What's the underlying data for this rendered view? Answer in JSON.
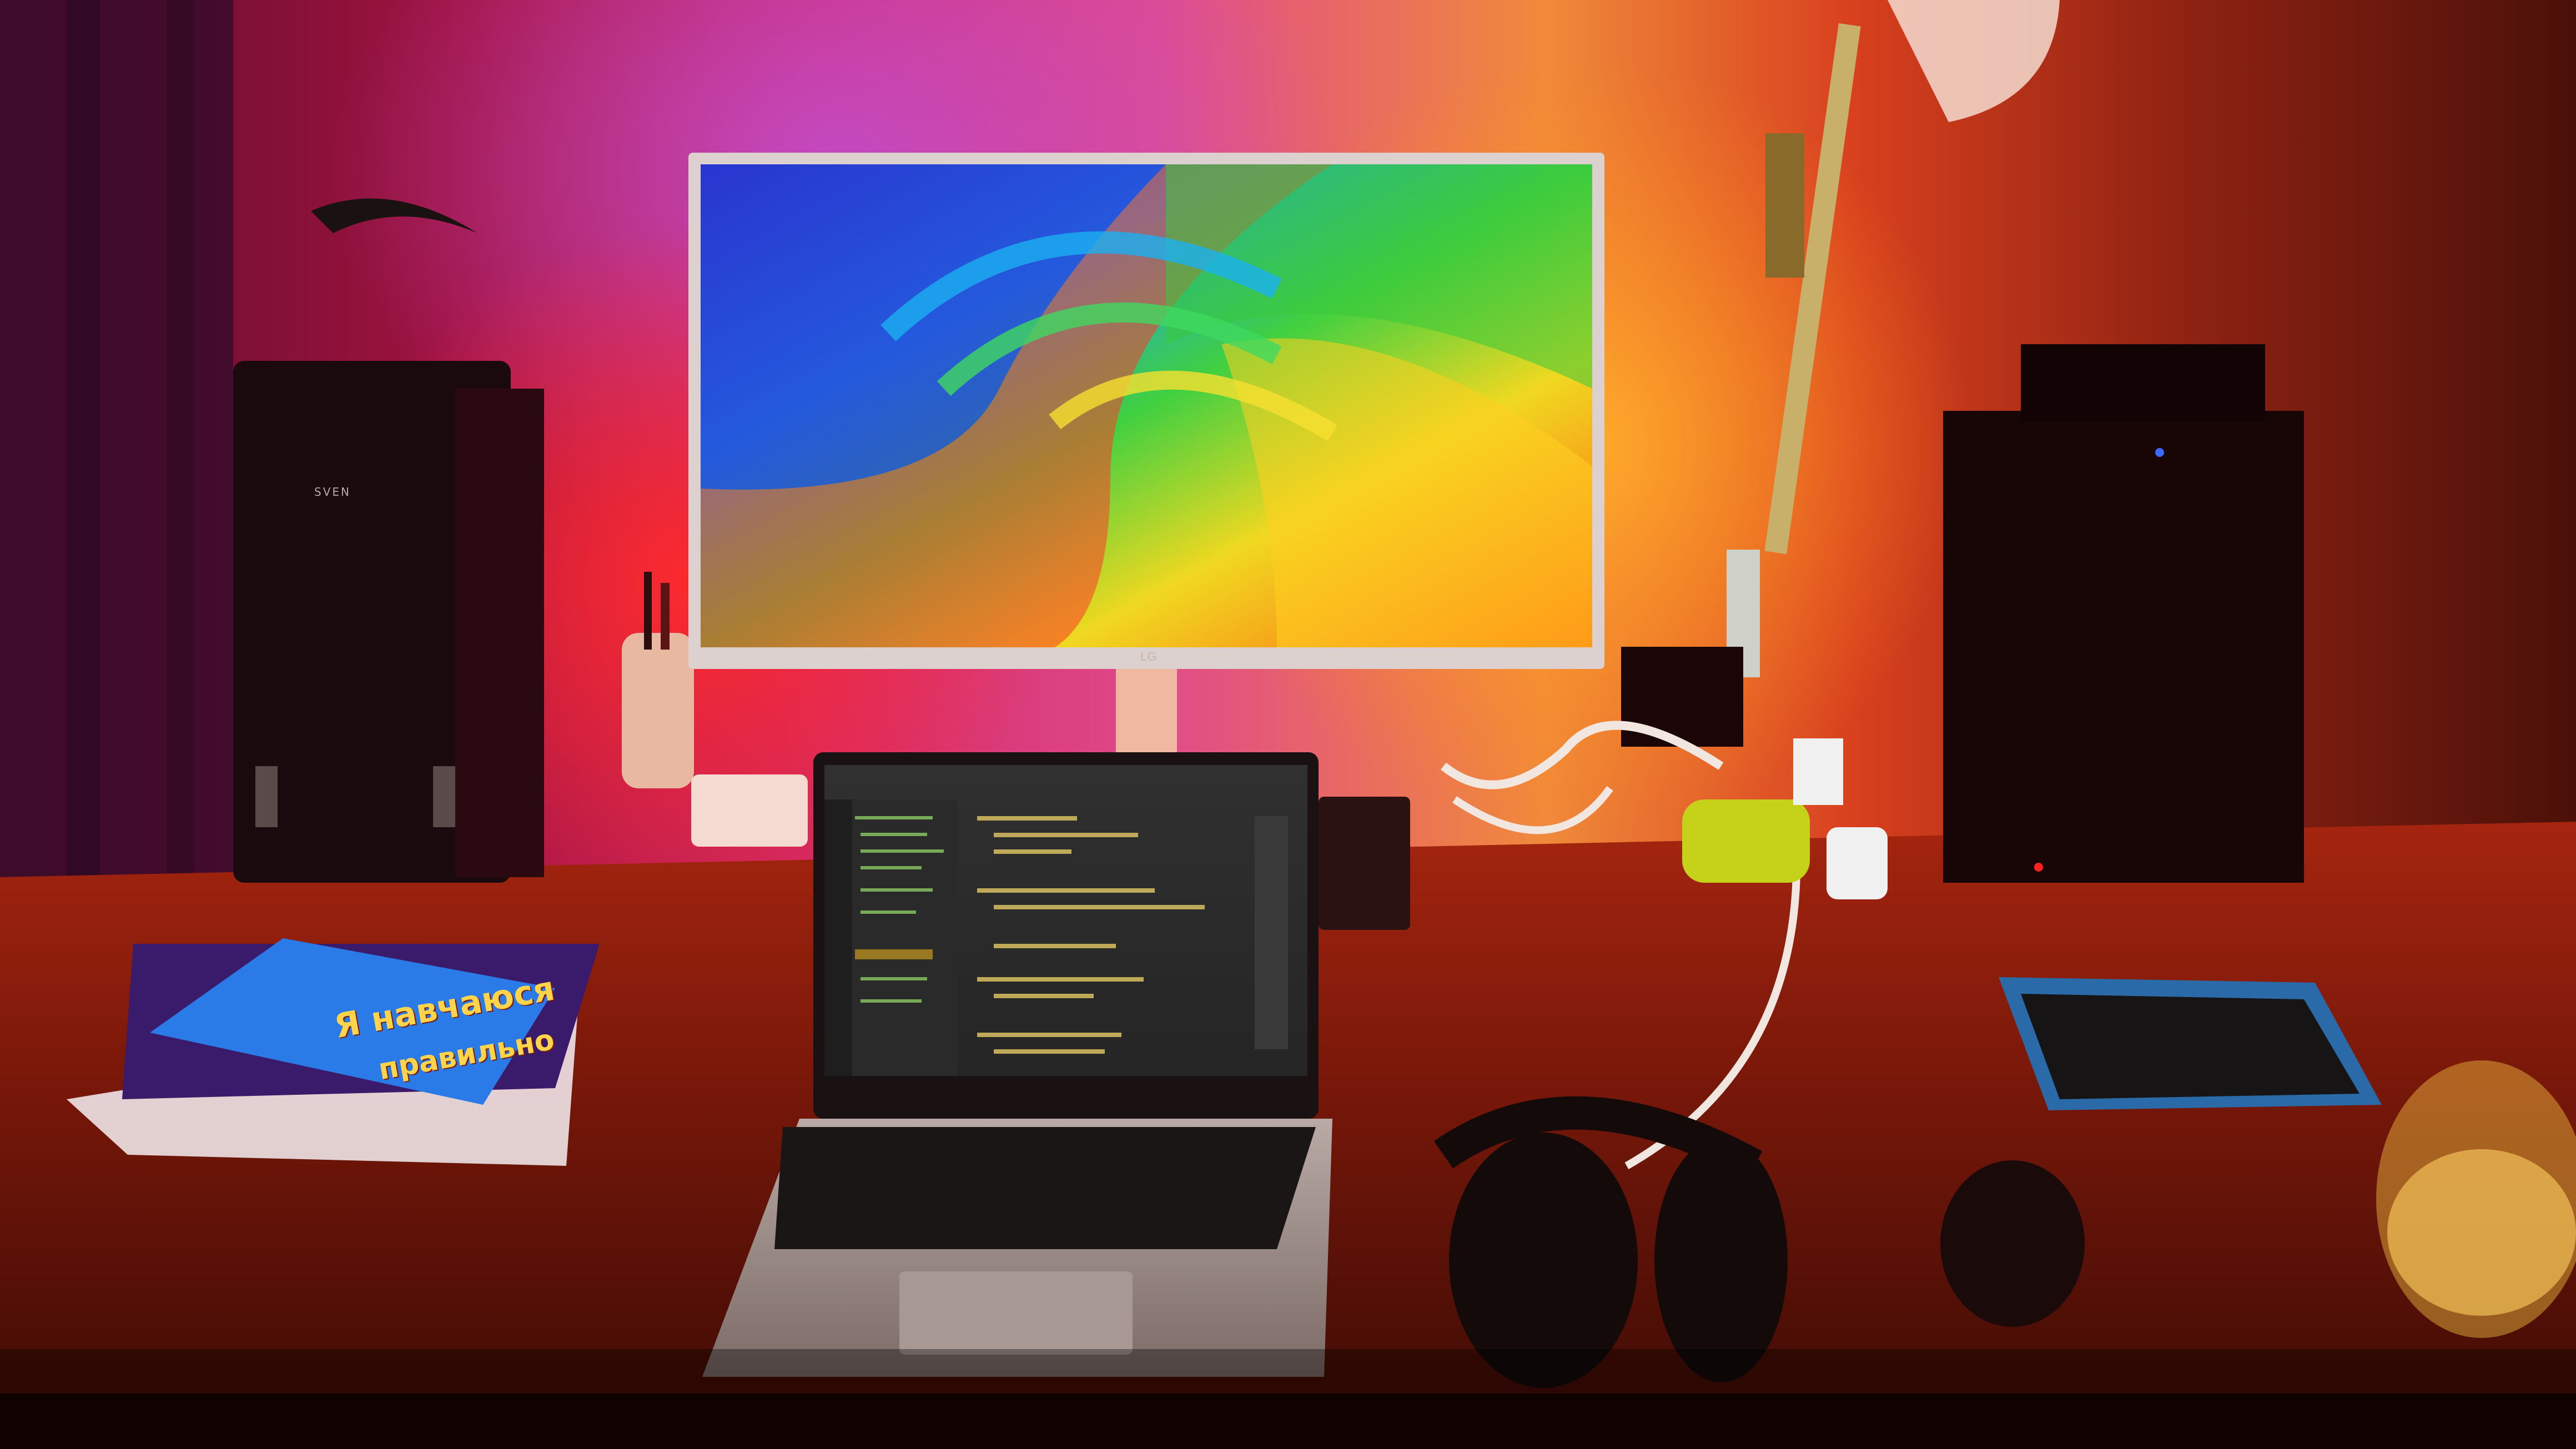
{
  "scene": {
    "description_labels": {
      "speaker_brand": "SVEN",
      "monitor_brand": "LG",
      "book_title": "Я навчаюся",
      "book_subtitle": "правильно"
    }
  },
  "icons": {
    "monitor": "monitor-icon",
    "laptop": "laptop-icon",
    "headphones": "headphones-icon",
    "speaker": "speaker-icon",
    "lamp": "desk-lamp-icon",
    "tablet": "tablet-icon",
    "glass": "glass-icon",
    "mouse": "mouse-icon"
  },
  "colors": {
    "wall_left": "#b3123a",
    "wall_center": "#e23a1e",
    "wall_right": "#8a1e12",
    "desk": "#7a1a0e",
    "backlight_pink": "#ff2a6a",
    "backlight_orange": "#ff8a1a"
  }
}
